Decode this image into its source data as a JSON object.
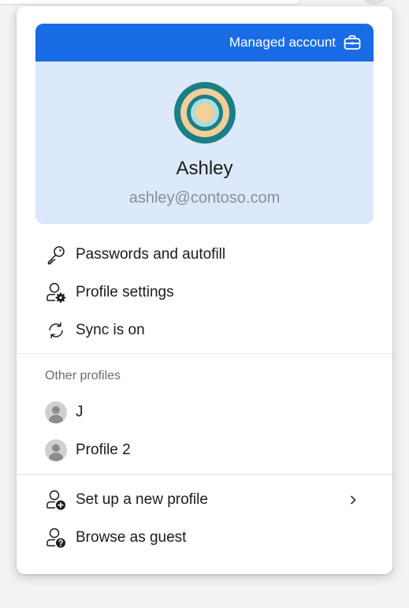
{
  "account_card": {
    "managed_label": "Managed account",
    "name": "Ashley",
    "email": "ashley@contoso.com",
    "bar_color": "#1a6be6",
    "card_color": "#dbe9fb"
  },
  "menu": {
    "passwords": "Passwords and autofill",
    "profile_settings": "Profile settings",
    "sync": "Sync is on"
  },
  "other_profiles": {
    "title": "Other profiles",
    "items": [
      "J",
      "Profile 2"
    ]
  },
  "actions": {
    "new_profile": "Set up a new profile",
    "guest": "Browse as guest"
  },
  "icons": {
    "managed": "briefcase-icon",
    "passwords": "key-icon",
    "profile_settings": "person-gear-icon",
    "sync": "sync-icon",
    "profile_avatar": "generic-person-icon",
    "new_profile": "person-add-icon",
    "guest": "person-question-icon",
    "expand": "chevron-right-icon"
  }
}
